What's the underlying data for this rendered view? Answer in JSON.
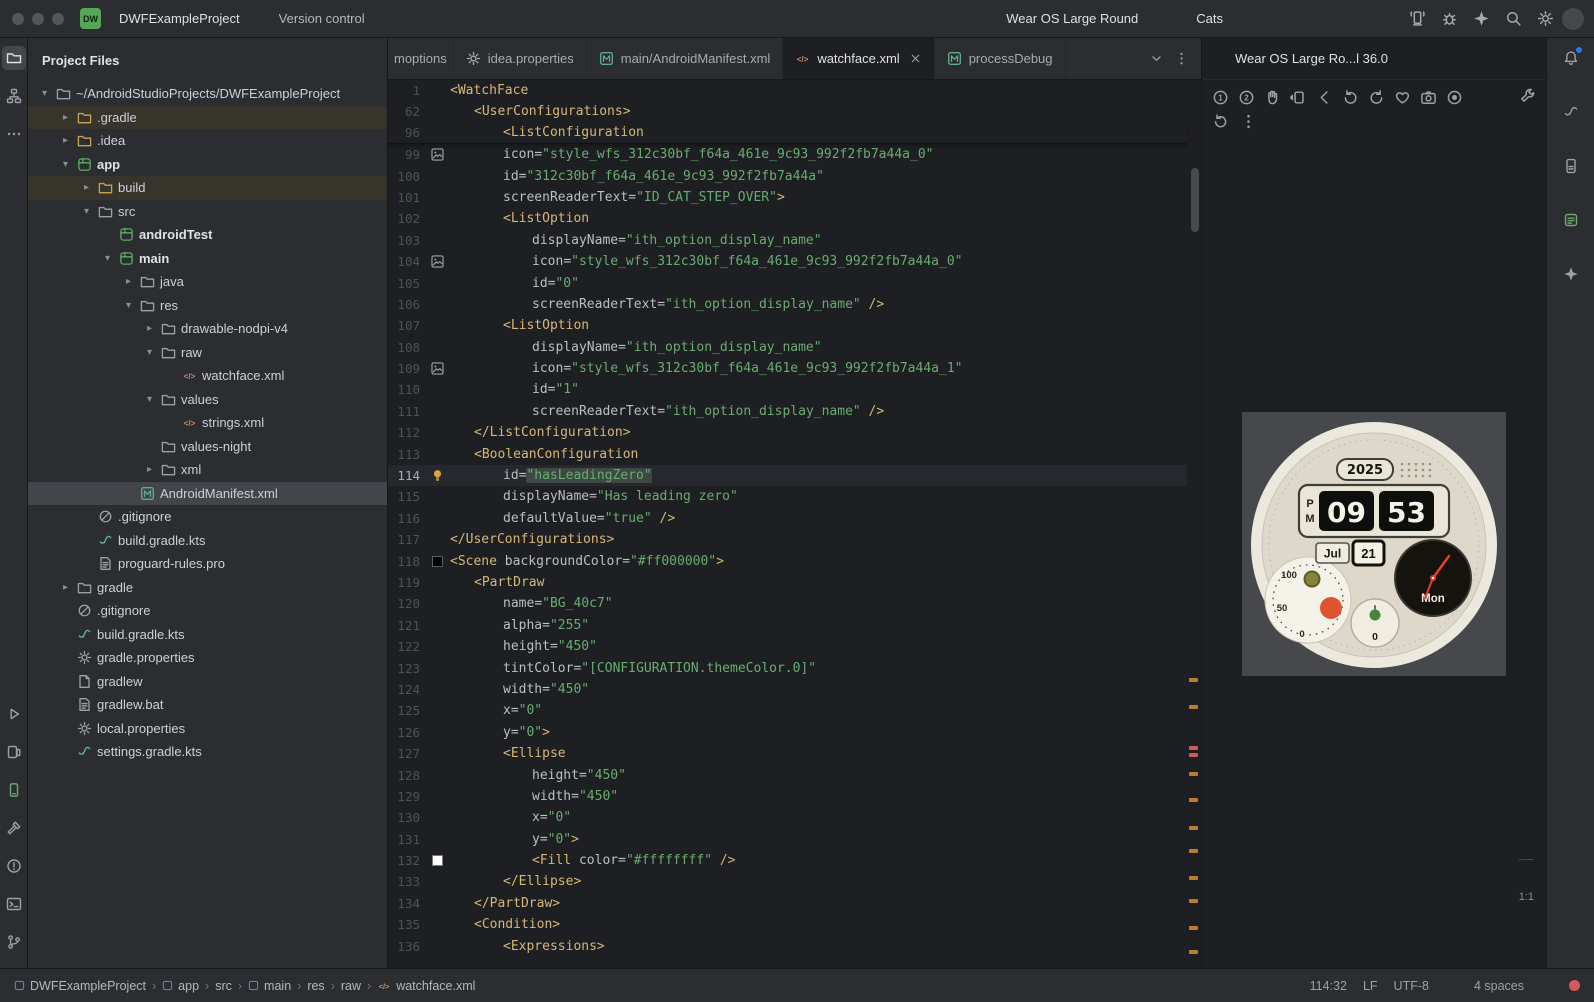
{
  "titlebar": {
    "logo": "DW",
    "project": "DWFExampleProject",
    "vcs": "Version control",
    "device": "Wear OS Large Round",
    "run_config": "Cats",
    "right_icons": [
      "device-streaming",
      "troubleshoot",
      "gemini",
      "search",
      "settings"
    ],
    "run_icons": [
      "run"
    ],
    "after_run_icons": [
      "troubleshoot",
      "more-v"
    ]
  },
  "left_strip": {
    "top": [
      {
        "id": "project",
        "active": true
      },
      {
        "id": "structure"
      },
      {
        "id": "more"
      }
    ],
    "bottom": [
      {
        "id": "run"
      },
      {
        "id": "running-devices"
      },
      {
        "id": "device-manager",
        "accent": "green"
      },
      {
        "id": "build"
      },
      {
        "id": "problems"
      },
      {
        "id": "terminal"
      },
      {
        "id": "version-control"
      }
    ]
  },
  "right_strip": {
    "items": [
      {
        "id": "notifications",
        "badge": true
      },
      {
        "id": "gradle"
      },
      {
        "id": "device-explorer"
      },
      {
        "id": "logcat",
        "accent": "green"
      },
      {
        "id": "gemini"
      }
    ]
  },
  "project_panel": {
    "title": "Project Files",
    "tree": [
      {
        "label": "~/AndroidStudioProjects/DWFExampleProject",
        "depth": 0,
        "icon": "folder",
        "chev": "open"
      },
      {
        "label": ".gradle",
        "depth": 1,
        "icon": "folder-excl",
        "chev": "closed",
        "tint": true
      },
      {
        "label": ".idea",
        "depth": 1,
        "icon": "folder-excl",
        "chev": "closed"
      },
      {
        "label": "app",
        "depth": 1,
        "icon": "module",
        "chev": "open",
        "bold": true
      },
      {
        "label": "build",
        "depth": 2,
        "icon": "folder-excl",
        "chev": "closed",
        "tint": true
      },
      {
        "label": "src",
        "depth": 2,
        "icon": "folder",
        "chev": "open"
      },
      {
        "label": "androidTest",
        "depth": 3,
        "icon": "module-src",
        "chev": "none",
        "bold": true
      },
      {
        "label": "main",
        "depth": 3,
        "icon": "module-src",
        "chev": "open",
        "bold": true
      },
      {
        "label": "java",
        "depth": 4,
        "icon": "folder",
        "chev": "closed"
      },
      {
        "label": "res",
        "depth": 4,
        "icon": "folder",
        "chev": "open"
      },
      {
        "label": "drawable-nodpi-v4",
        "depth": 5,
        "icon": "folder",
        "chev": "closed"
      },
      {
        "label": "raw",
        "depth": 5,
        "icon": "folder",
        "chev": "open"
      },
      {
        "label": "watchface.xml",
        "depth": 6,
        "icon": "xml",
        "chev": "none"
      },
      {
        "label": "values",
        "depth": 5,
        "icon": "folder",
        "chev": "open"
      },
      {
        "label": "strings.xml",
        "depth": 6,
        "icon": "xml",
        "chev": "none"
      },
      {
        "label": "values-night",
        "depth": 5,
        "icon": "folder",
        "chev": "none"
      },
      {
        "label": "xml",
        "depth": 5,
        "icon": "folder",
        "chev": "closed"
      },
      {
        "label": "AndroidManifest.xml",
        "depth": 4,
        "icon": "manifest",
        "chev": "none",
        "selected": true
      },
      {
        "label": ".gitignore",
        "depth": 2,
        "icon": "ignore",
        "chev": "none"
      },
      {
        "label": "build.gradle.kts",
        "depth": 2,
        "icon": "gradle",
        "chev": "none"
      },
      {
        "label": "proguard-rules.pro",
        "depth": 2,
        "icon": "textfile",
        "chev": "none"
      },
      {
        "label": "gradle",
        "depth": 1,
        "icon": "folder",
        "chev": "closed"
      },
      {
        "label": ".gitignore",
        "depth": 1,
        "icon": "ignore",
        "chev": "none"
      },
      {
        "label": "build.gradle.kts",
        "depth": 1,
        "icon": "gradle",
        "chev": "none"
      },
      {
        "label": "gradle.properties",
        "depth": 1,
        "icon": "props",
        "chev": "none"
      },
      {
        "label": "gradlew",
        "depth": 1,
        "icon": "file",
        "chev": "none"
      },
      {
        "label": "gradlew.bat",
        "depth": 1,
        "icon": "textfile",
        "chev": "none"
      },
      {
        "label": "local.properties",
        "depth": 1,
        "icon": "props",
        "chev": "none"
      },
      {
        "label": "settings.gradle.kts",
        "depth": 1,
        "icon": "gradle",
        "chev": "none"
      }
    ]
  },
  "editor": {
    "tabs": [
      {
        "label": "moptions",
        "icon": null,
        "clip": true
      },
      {
        "label": "idea.properties",
        "icon": "props"
      },
      {
        "label": "main/AndroidManifest.xml",
        "icon": "manifest"
      },
      {
        "label": "watchface.xml",
        "icon": "xml",
        "active": true,
        "close": true
      },
      {
        "label": "processDebug",
        "icon": "manifest"
      }
    ],
    "lines": [
      {
        "n": 1,
        "ind": 0,
        "parts": [
          [
            "t",
            "<WatchFace"
          ]
        ]
      },
      {
        "n": 62,
        "ind": 1,
        "parts": [
          [
            "t",
            "<UserConfigurations>"
          ]
        ]
      },
      {
        "n": 96,
        "ind": 2,
        "last": true,
        "parts": [
          [
            "t",
            "<ListConfiguration"
          ]
        ]
      },
      {
        "n": 99,
        "ind": 2,
        "g": "img",
        "parts": [
          [
            "a",
            "icon"
          ],
          [
            "p",
            "="
          ],
          [
            "v",
            "\"style_wfs_312c30bf_f64a_461e_9c93_992f2fb7a44a_0\""
          ]
        ]
      },
      {
        "n": 100,
        "ind": 2,
        "parts": [
          [
            "a",
            "id"
          ],
          [
            "p",
            "="
          ],
          [
            "v",
            "\"312c30bf_f64a_461e_9c93_992f2fb7a44a\""
          ]
        ]
      },
      {
        "n": 101,
        "ind": 2,
        "parts": [
          [
            "a",
            "screenReaderText"
          ],
          [
            "p",
            "="
          ],
          [
            "v",
            "\"ID_CAT_STEP_OVER\""
          ],
          [
            "t",
            ">"
          ]
        ]
      },
      {
        "n": 102,
        "ind": 2,
        "parts": [
          [
            "t",
            "<ListOption"
          ]
        ]
      },
      {
        "n": 103,
        "ind": 3,
        "parts": [
          [
            "a",
            "displayName"
          ],
          [
            "p",
            "="
          ],
          [
            "v",
            "\"ith_option_display_name\""
          ]
        ]
      },
      {
        "n": 104,
        "ind": 3,
        "g": "img",
        "parts": [
          [
            "a",
            "icon"
          ],
          [
            "p",
            "="
          ],
          [
            "v",
            "\"style_wfs_312c30bf_f64a_461e_9c93_992f2fb7a44a_0\""
          ]
        ]
      },
      {
        "n": 105,
        "ind": 3,
        "parts": [
          [
            "a",
            "id"
          ],
          [
            "p",
            "="
          ],
          [
            "v",
            "\"0\""
          ]
        ]
      },
      {
        "n": 106,
        "ind": 3,
        "parts": [
          [
            "a",
            "screenReaderText"
          ],
          [
            "p",
            "="
          ],
          [
            "v",
            "\"ith_option_display_name\""
          ],
          [
            "t",
            " />"
          ]
        ]
      },
      {
        "n": 107,
        "ind": 2,
        "parts": [
          [
            "t",
            "<ListOption"
          ]
        ]
      },
      {
        "n": 108,
        "ind": 3,
        "parts": [
          [
            "a",
            "displayName"
          ],
          [
            "p",
            "="
          ],
          [
            "v",
            "\"ith_option_display_name\""
          ]
        ]
      },
      {
        "n": 109,
        "ind": 3,
        "g": "img",
        "parts": [
          [
            "a",
            "icon"
          ],
          [
            "p",
            "="
          ],
          [
            "v",
            "\"style_wfs_312c30bf_f64a_461e_9c93_992f2fb7a44a_1\""
          ]
        ]
      },
      {
        "n": 110,
        "ind": 3,
        "parts": [
          [
            "a",
            "id"
          ],
          [
            "p",
            "="
          ],
          [
            "v",
            "\"1\""
          ]
        ]
      },
      {
        "n": 111,
        "ind": 3,
        "parts": [
          [
            "a",
            "screenReaderText"
          ],
          [
            "p",
            "="
          ],
          [
            "v",
            "\"ith_option_display_name\""
          ],
          [
            "t",
            " />"
          ]
        ]
      },
      {
        "n": 112,
        "ind": 1,
        "parts": [
          [
            "t",
            "</ListConfiguration>"
          ]
        ]
      },
      {
        "n": 113,
        "ind": 1,
        "parts": [
          [
            "t",
            "<BooleanConfiguration"
          ]
        ]
      },
      {
        "n": 114,
        "ind": 2,
        "g": "bulb",
        "cur": true,
        "parts": [
          [
            "a",
            "id"
          ],
          [
            "p",
            "="
          ],
          [
            "h",
            "\"hasLeadingZero\""
          ]
        ]
      },
      {
        "n": 115,
        "ind": 2,
        "parts": [
          [
            "a",
            "displayName"
          ],
          [
            "p",
            "="
          ],
          [
            "v",
            "\"Has leading zero\""
          ]
        ]
      },
      {
        "n": 116,
        "ind": 2,
        "parts": [
          [
            "a",
            "defaultValue"
          ],
          [
            "p",
            "="
          ],
          [
            "v",
            "\"true\""
          ],
          [
            "t",
            " />"
          ]
        ]
      },
      {
        "n": 117,
        "ind": 0,
        "parts": [
          [
            "t",
            "</UserConfigurations>"
          ]
        ]
      },
      {
        "n": 118,
        "ind": 0,
        "g": "cb",
        "parts": [
          [
            "t",
            "<Scene "
          ],
          [
            "a",
            "backgroundColor"
          ],
          [
            "p",
            "="
          ],
          [
            "v",
            "\"#ff000000\""
          ],
          [
            "t",
            ">"
          ]
        ]
      },
      {
        "n": 119,
        "ind": 1,
        "parts": [
          [
            "t",
            "<PartDraw"
          ]
        ]
      },
      {
        "n": 120,
        "ind": 2,
        "parts": [
          [
            "a",
            "name"
          ],
          [
            "p",
            "="
          ],
          [
            "v",
            "\"BG_40c7\""
          ]
        ]
      },
      {
        "n": 121,
        "ind": 2,
        "parts": [
          [
            "a",
            "alpha"
          ],
          [
            "p",
            "="
          ],
          [
            "v",
            "\"255\""
          ]
        ]
      },
      {
        "n": 122,
        "ind": 2,
        "parts": [
          [
            "a",
            "height"
          ],
          [
            "p",
            "="
          ],
          [
            "v",
            "\"450\""
          ]
        ]
      },
      {
        "n": 123,
        "ind": 2,
        "parts": [
          [
            "a",
            "tintColor"
          ],
          [
            "p",
            "="
          ],
          [
            "v",
            "\"[CONFIGURATION.themeColor.0]\""
          ]
        ]
      },
      {
        "n": 124,
        "ind": 2,
        "parts": [
          [
            "a",
            "width"
          ],
          [
            "p",
            "="
          ],
          [
            "v",
            "\"450\""
          ]
        ]
      },
      {
        "n": 125,
        "ind": 2,
        "parts": [
          [
            "a",
            "x"
          ],
          [
            "p",
            "="
          ],
          [
            "v",
            "\"0\""
          ]
        ]
      },
      {
        "n": 126,
        "ind": 2,
        "parts": [
          [
            "a",
            "y"
          ],
          [
            "p",
            "="
          ],
          [
            "v",
            "\"0\""
          ],
          [
            "t",
            ">"
          ]
        ]
      },
      {
        "n": 127,
        "ind": 2,
        "parts": [
          [
            "t",
            "<Ellipse"
          ]
        ]
      },
      {
        "n": 128,
        "ind": 3,
        "parts": [
          [
            "a",
            "height"
          ],
          [
            "p",
            "="
          ],
          [
            "v",
            "\"450\""
          ]
        ]
      },
      {
        "n": 129,
        "ind": 3,
        "parts": [
          [
            "a",
            "width"
          ],
          [
            "p",
            "="
          ],
          [
            "v",
            "\"450\""
          ]
        ]
      },
      {
        "n": 130,
        "ind": 3,
        "parts": [
          [
            "a",
            "x"
          ],
          [
            "p",
            "="
          ],
          [
            "v",
            "\"0\""
          ]
        ]
      },
      {
        "n": 131,
        "ind": 3,
        "parts": [
          [
            "a",
            "y"
          ],
          [
            "p",
            "="
          ],
          [
            "v",
            "\"0\""
          ],
          [
            "t",
            ">"
          ]
        ]
      },
      {
        "n": 132,
        "ind": 3,
        "g": "cw",
        "parts": [
          [
            "t",
            "<Fill "
          ],
          [
            "a",
            "color"
          ],
          [
            "p",
            "="
          ],
          [
            "v",
            "\"#ffffffff\""
          ],
          [
            "t",
            " />"
          ]
        ]
      },
      {
        "n": 133,
        "ind": 2,
        "parts": [
          [
            "t",
            "</Ellipse>"
          ]
        ]
      },
      {
        "n": 134,
        "ind": 1,
        "parts": [
          [
            "t",
            "</PartDraw>"
          ]
        ]
      },
      {
        "n": 135,
        "ind": 1,
        "parts": [
          [
            "t",
            "<Condition>"
          ]
        ]
      },
      {
        "n": 136,
        "ind": 2,
        "parts": [
          [
            "t",
            "<Expressions>"
          ]
        ]
      }
    ],
    "stripe": [
      {
        "t": 598,
        "c": "o"
      },
      {
        "t": 625,
        "c": "o"
      },
      {
        "t": 666,
        "c": "r"
      },
      {
        "t": 673,
        "c": "r"
      },
      {
        "t": 692,
        "c": "o"
      },
      {
        "t": 718,
        "c": "o"
      },
      {
        "t": 746,
        "c": "o"
      },
      {
        "t": 769,
        "c": "o"
      },
      {
        "t": 796,
        "c": "o"
      },
      {
        "t": 819,
        "c": "o"
      },
      {
        "t": 846,
        "c": "o"
      },
      {
        "t": 870,
        "c": "o"
      }
    ],
    "stripe_colors": {
      "o": "#b97f2f",
      "r": "#d15a5a"
    }
  },
  "devices_panel": {
    "tab_title": "Wear OS Large Ro...l 36.0",
    "toolbar_row1": [
      "button-1",
      "button-2",
      "palm",
      "tilt",
      "back",
      "rotate-left",
      "rotate-right",
      "heart-rate",
      "screenshot",
      "screen-record"
    ],
    "toolbar_row1_right": [
      "device-settings"
    ],
    "toolbar_row2": [
      "reset",
      "more-v"
    ],
    "zoom_label": "1:1",
    "watch": {
      "year": "2025",
      "ampm_1": "P",
      "ampm_2": "M",
      "hh": "09",
      "mm": "53",
      "month": "Jul",
      "day": "21",
      "weekday": "Mon",
      "gauge": [
        "100",
        "50",
        "0"
      ],
      "steps": "0"
    }
  },
  "statusbar": {
    "breadcrumbs": [
      {
        "label": "DWFExampleProject",
        "icon": "mod"
      },
      {
        "label": "app",
        "icon": "mod"
      },
      {
        "label": "src"
      },
      {
        "label": "main",
        "icon": "mod"
      },
      {
        "label": "res"
      },
      {
        "label": "raw"
      },
      {
        "label": "watchface.xml",
        "icon": "xmlfile"
      }
    ],
    "position": "114:32",
    "line_separator": "LF",
    "encoding": "UTF-8",
    "indent": "4 spaces"
  }
}
